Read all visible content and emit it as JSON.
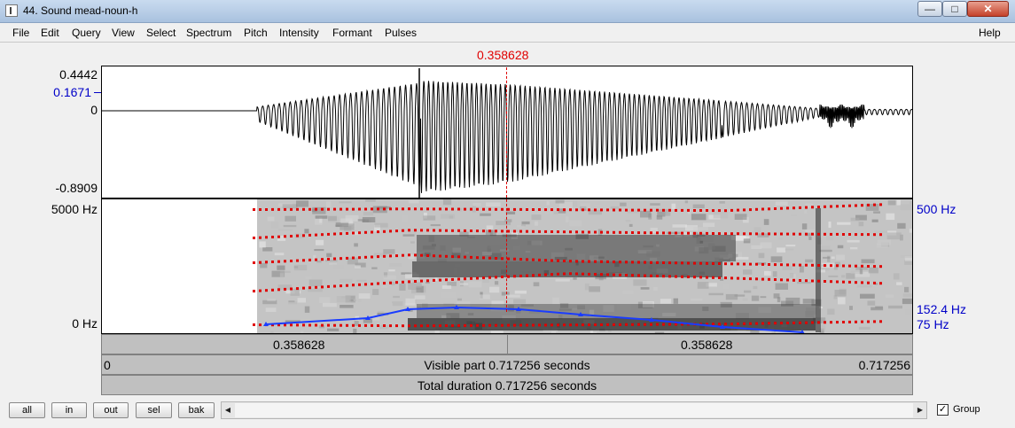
{
  "window": {
    "title": "44. Sound mead-noun-h"
  },
  "controls": {
    "minimize": "—",
    "maximize": "□",
    "close": "✕"
  },
  "menu": [
    "File",
    "Edit",
    "Query",
    "View",
    "Select",
    "Spectrum",
    "Pitch",
    "Intensity",
    "Formant",
    "Pulses"
  ],
  "help": "Help",
  "cursor_time": "0.358628",
  "waveform": {
    "max": "0.4442",
    "cursor_value": "0.1671",
    "zero": "0",
    "min": "-0.8909"
  },
  "spectrogram": {
    "freq_top": "5000 Hz",
    "freq_bottom": "0 Hz",
    "pitch_top": "500 Hz",
    "pitch_value": "152.4 Hz",
    "pitch_bottom": "75 Hz"
  },
  "selection": {
    "left": "0.358628",
    "right": "0.358628"
  },
  "visible": {
    "start": "0",
    "text": "Visible part 0.717256 seconds",
    "end": "0.717256"
  },
  "total": {
    "text": "Total duration 0.717256 seconds"
  },
  "buttons": [
    "all",
    "in",
    "out",
    "sel",
    "bak"
  ],
  "group": {
    "label": "Group",
    "checked": true
  },
  "icons": {
    "app": "app-icon",
    "scroll_left": "left-arrow-icon",
    "scroll_right": "right-arrow-icon",
    "check": "checkmark-icon"
  },
  "colors": {
    "cursor": "#e00000",
    "axis_blue": "#0000c8",
    "formant": "#e00000",
    "pitch": "#1a3cff"
  }
}
